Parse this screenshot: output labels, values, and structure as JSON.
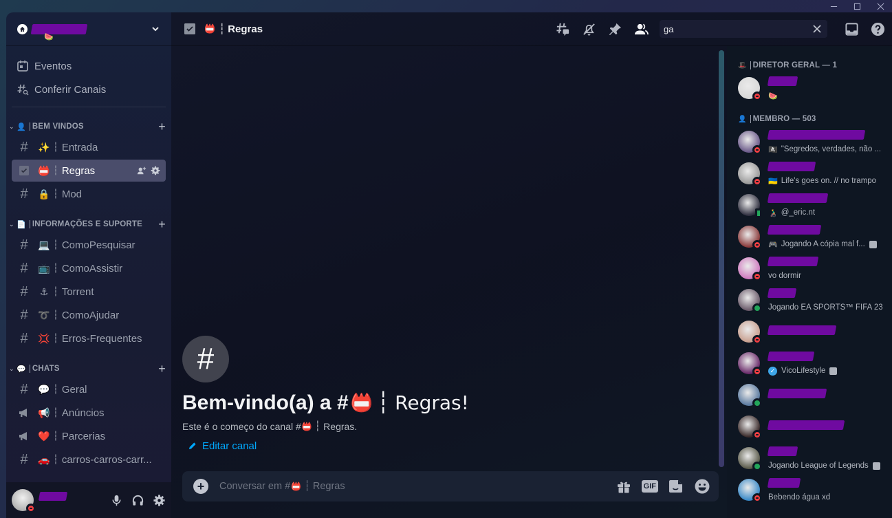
{
  "window": {
    "controls": [
      "minimize",
      "maximize",
      "close"
    ]
  },
  "server": {
    "name_redacted": true
  },
  "sidebar": {
    "top_items": [
      {
        "label": "Eventos",
        "icon": "calendar-icon"
      },
      {
        "label": "Conferir Canais",
        "icon": "browse-channels-icon"
      }
    ],
    "categories": [
      {
        "name": "BEM VINDOS",
        "emoji": "👤",
        "channels": [
          {
            "name": "Entrada",
            "emoji": "✨",
            "type": "text"
          },
          {
            "name": "Regras",
            "emoji": "📛",
            "type": "rules",
            "active": true
          },
          {
            "name": "Mod",
            "emoji": "🔒",
            "type": "text-locked"
          }
        ]
      },
      {
        "name": "INFORMAÇÕES E SUPORTE",
        "emoji": "📄",
        "channels": [
          {
            "name": "ComoPesquisar",
            "emoji": "💻",
            "type": "text"
          },
          {
            "name": "ComoAssistir",
            "emoji": "📺",
            "type": "text"
          },
          {
            "name": "Torrent",
            "emoji": "⚓",
            "type": "text"
          },
          {
            "name": "ComoAjudar",
            "emoji": "➰",
            "type": "text-locked"
          },
          {
            "name": "Erros-Frequentes",
            "emoji": "💢",
            "type": "text"
          }
        ]
      },
      {
        "name": "CHATS",
        "emoji": "💬",
        "channels": [
          {
            "name": "Geral",
            "emoji": "💬",
            "type": "text"
          },
          {
            "name": "Anúncios",
            "emoji": "📢",
            "type": "announcement"
          },
          {
            "name": "Parcerias",
            "emoji": "❤️",
            "type": "announcement"
          },
          {
            "name": "carros-carros-carr...",
            "emoji": "🚗",
            "type": "text"
          }
        ]
      }
    ]
  },
  "user_panel": {
    "custom_status_emoji": "🍉",
    "status": "dnd"
  },
  "header": {
    "channel_emoji": "📛",
    "channel_name": "Regras",
    "search_value": "ga",
    "icons": [
      "threads-icon",
      "mute-bell-icon",
      "pin-icon",
      "members-icon",
      "inbox-icon",
      "help-icon"
    ]
  },
  "welcome": {
    "title_prefix": "Bem-vindo(a) a #",
    "title_emoji": "📛",
    "title_name": "Regras!",
    "subtitle_prefix": "Este é o começo do canal #",
    "subtitle_emoji": "📛",
    "subtitle_name": "Regras.",
    "edit_label": "Editar canal"
  },
  "composer": {
    "placeholder_prefix": "Conversar em #",
    "placeholder_emoji": "📛",
    "placeholder_name": "Regras",
    "gif_label": "GIF"
  },
  "members": {
    "groups": [
      {
        "emoji": "🎩",
        "label": "DIRETOR GERAL — 1",
        "members": [
          {
            "status": "dnd",
            "activity_emoji": "🍉",
            "activity": "",
            "avatar_color": "#d8d8d8",
            "name_width": 42
          }
        ]
      },
      {
        "emoji": "👤",
        "label": "MEMBRO — 503",
        "members": [
          {
            "status": "dnd",
            "activity_emoji": "🏴‍☠️",
            "activity": "\"Segredos, verdades, não ...",
            "avatar_color": "#6b5a8a",
            "name_width": 140
          },
          {
            "status": "dnd",
            "activity_emoji": "🇺🇦",
            "activity": "Life's goes on. // no trampo",
            "avatar_color": "#9a9a9a",
            "name_width": 68
          },
          {
            "status": "mobile",
            "activity_emoji": "👨‍🦽",
            "activity": "@_eric.nt",
            "avatar_color": "#303040",
            "name_width": 86
          },
          {
            "status": "dnd",
            "activity_emoji": "🎮",
            "activity": "Jogando A cópia mal f...",
            "rich": true,
            "avatar_color": "#8a3a3a",
            "name_width": 76
          },
          {
            "status": "dnd",
            "activity_emoji": "",
            "activity": "vo dormir",
            "avatar_color": "#d07ac0",
            "name_width": 72
          },
          {
            "status": "online",
            "activity_emoji": "",
            "activity": "Jogando EA SPORTS™ FIFA 23",
            "avatar_color": "#6a5a6a",
            "name_width": 40
          },
          {
            "status": "dnd",
            "activity_emoji": "",
            "activity": "",
            "avatar_color": "#c8a090",
            "name_width": 98
          },
          {
            "status": "dnd",
            "activity_emoji": "",
            "activity": "VicoLifestyle",
            "verified": true,
            "rich": true,
            "avatar_color": "#6a2a6a",
            "name_width": 66
          },
          {
            "status": "online",
            "activity_emoji": "",
            "activity": "",
            "avatar_color": "#5a7aa0",
            "name_width": 84
          },
          {
            "status": "dnd",
            "activity_emoji": "",
            "activity": "",
            "avatar_color": "#3a2a2a",
            "name_width": 110
          },
          {
            "status": "online",
            "activity_emoji": "",
            "activity": "Jogando League of Legends",
            "rich": true,
            "avatar_color": "#5a5a4a",
            "name_width": 42
          },
          {
            "status": "dnd",
            "activity_emoji": "",
            "activity": "Bebendo água xd",
            "avatar_color": "#3a8ac8",
            "name_width": 46
          }
        ]
      }
    ]
  }
}
